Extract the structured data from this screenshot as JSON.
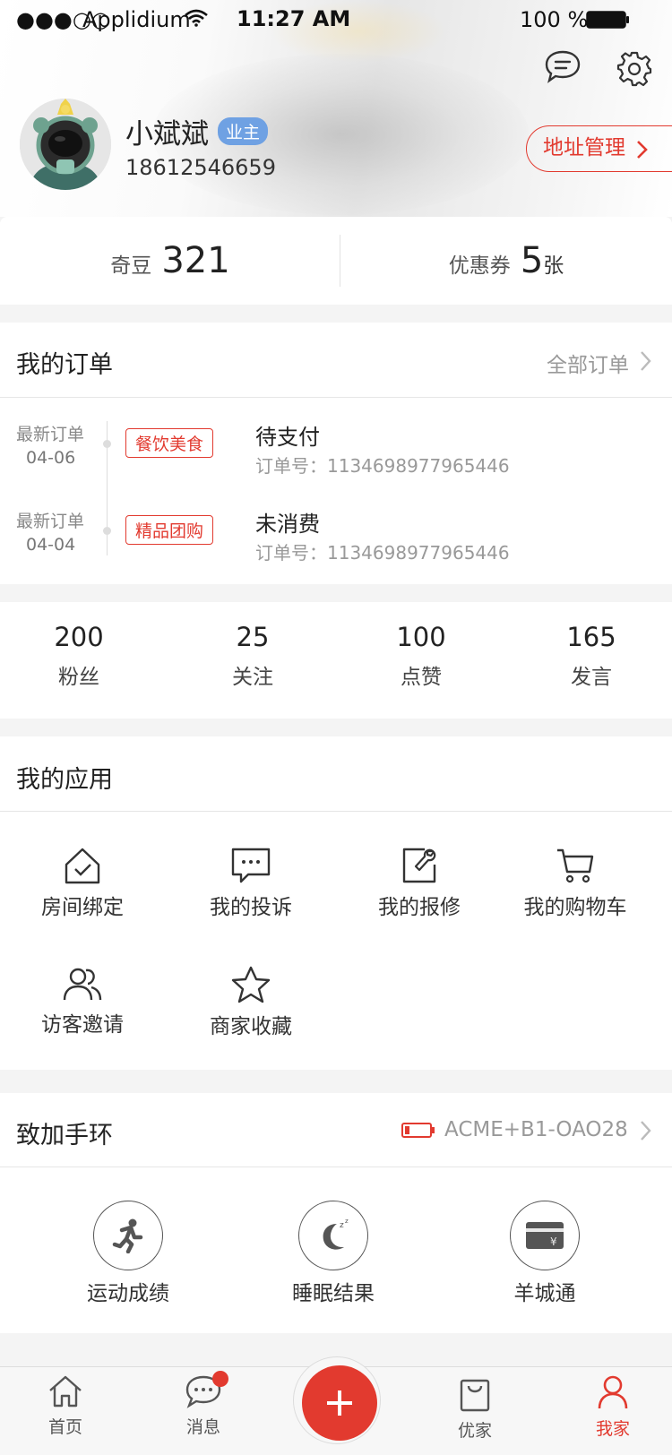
{
  "status_bar": {
    "signal": "●●●○○",
    "carrier": "Applidium",
    "time": "11:27 AM",
    "battery": "100 %"
  },
  "profile": {
    "name": "小斌斌",
    "role_badge": "业主",
    "phone": "18612546659",
    "address_button": "地址管理"
  },
  "points": {
    "qidou_label": "奇豆",
    "qidou_value": "321",
    "coupon_label": "优惠券",
    "coupon_value": "5",
    "coupon_unit": "张"
  },
  "orders": {
    "title": "我的订单",
    "all_link": "全部订单",
    "items": [
      {
        "latest_label": "最新订单",
        "date": "04-06",
        "category": "餐饮美食",
        "status": "待支付",
        "order_no_label": "订单号：",
        "order_no": "1134698977965446"
      },
      {
        "latest_label": "最新订单",
        "date": "04-04",
        "category": "精品团购",
        "status": "未消费",
        "order_no_label": "订单号：",
        "order_no": "1134698977965446"
      }
    ]
  },
  "stats": [
    {
      "value": "200",
      "label": "粉丝"
    },
    {
      "value": "25",
      "label": "关注"
    },
    {
      "value": "100",
      "label": "点赞"
    },
    {
      "value": "165",
      "label": "发言"
    }
  ],
  "apps": {
    "title": "我的应用",
    "items": [
      {
        "label": "房间绑定",
        "icon": "house-check-icon"
      },
      {
        "label": "我的投诉",
        "icon": "chat-bubble-icon"
      },
      {
        "label": "我的报修",
        "icon": "wrench-doc-icon"
      },
      {
        "label": "我的购物车",
        "icon": "cart-icon"
      },
      {
        "label": "访客邀请",
        "icon": "visitors-icon"
      },
      {
        "label": "商家收藏",
        "icon": "star-icon"
      }
    ]
  },
  "band": {
    "title": "致加手环",
    "device": "ACME+B1-OAO28",
    "items": [
      {
        "label": "运动成绩",
        "icon": "running-icon"
      },
      {
        "label": "睡眠结果",
        "icon": "moon-sleep-icon"
      },
      {
        "label": "羊城通",
        "icon": "card-icon"
      }
    ]
  },
  "tabbar": {
    "items": [
      {
        "label": "首页",
        "icon": "home-icon"
      },
      {
        "label": "消息",
        "icon": "message-icon"
      },
      {
        "label": "",
        "icon": "plus-icon"
      },
      {
        "label": "优家",
        "icon": "bag-icon"
      },
      {
        "label": "我家",
        "icon": "person-icon"
      }
    ],
    "active_color": "#e23a2f"
  },
  "colors": {
    "accent": "#e23a2f",
    "badge_blue": "#6fa1e3"
  }
}
